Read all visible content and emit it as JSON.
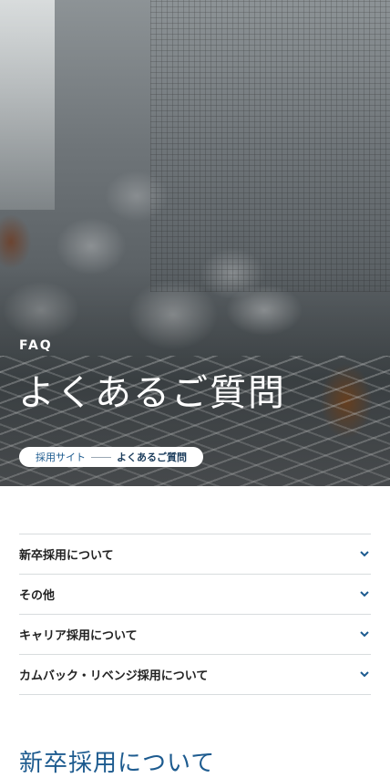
{
  "hero": {
    "label": "FAQ",
    "title": "よくあるご質問"
  },
  "breadcrumb": {
    "home": "採用サイト",
    "current": "よくあるご質問"
  },
  "faq_categories": [
    {
      "label": "新卒採用について",
      "icon": "chevron-down-icon"
    },
    {
      "label": "その他",
      "icon": "chevron-down-icon"
    },
    {
      "label": "キャリア採用について",
      "icon": "chevron-down-icon"
    },
    {
      "label": "カムバック・リベンジ採用について",
      "icon": "chevron-down-icon"
    }
  ],
  "section": {
    "title": "新卒採用について"
  },
  "colors": {
    "accent": "#1d5b8f",
    "text": "#222222",
    "divider": "#d8dcde"
  }
}
